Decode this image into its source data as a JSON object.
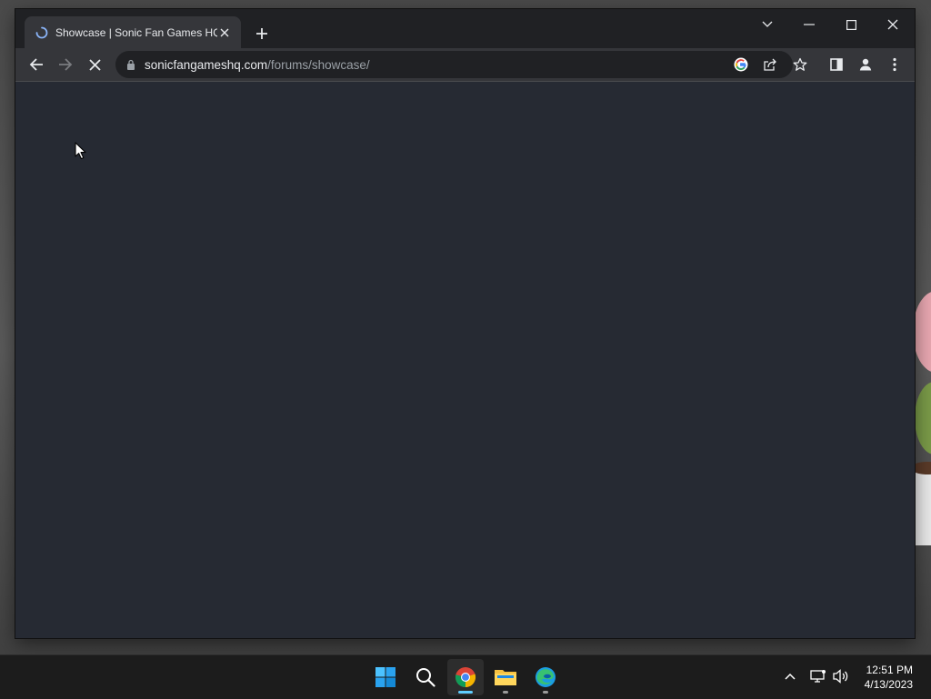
{
  "browser": {
    "tab": {
      "title": "Showcase | Sonic Fan Games HQ"
    },
    "url": {
      "host": "sonicfangameshq.com",
      "path": "/forums/showcase/"
    }
  },
  "taskbar": {
    "apps": [
      "start-icon",
      "search-icon",
      "chrome-icon",
      "file-explorer-icon",
      "edge-icon"
    ],
    "clock": {
      "time": "12:51 PM",
      "date": "4/13/2023"
    }
  },
  "colors": {
    "page_background": "#262a33",
    "tab_active": "#35363a",
    "chrome_dark": "#202124",
    "taskbar": "#1c1c1c"
  }
}
